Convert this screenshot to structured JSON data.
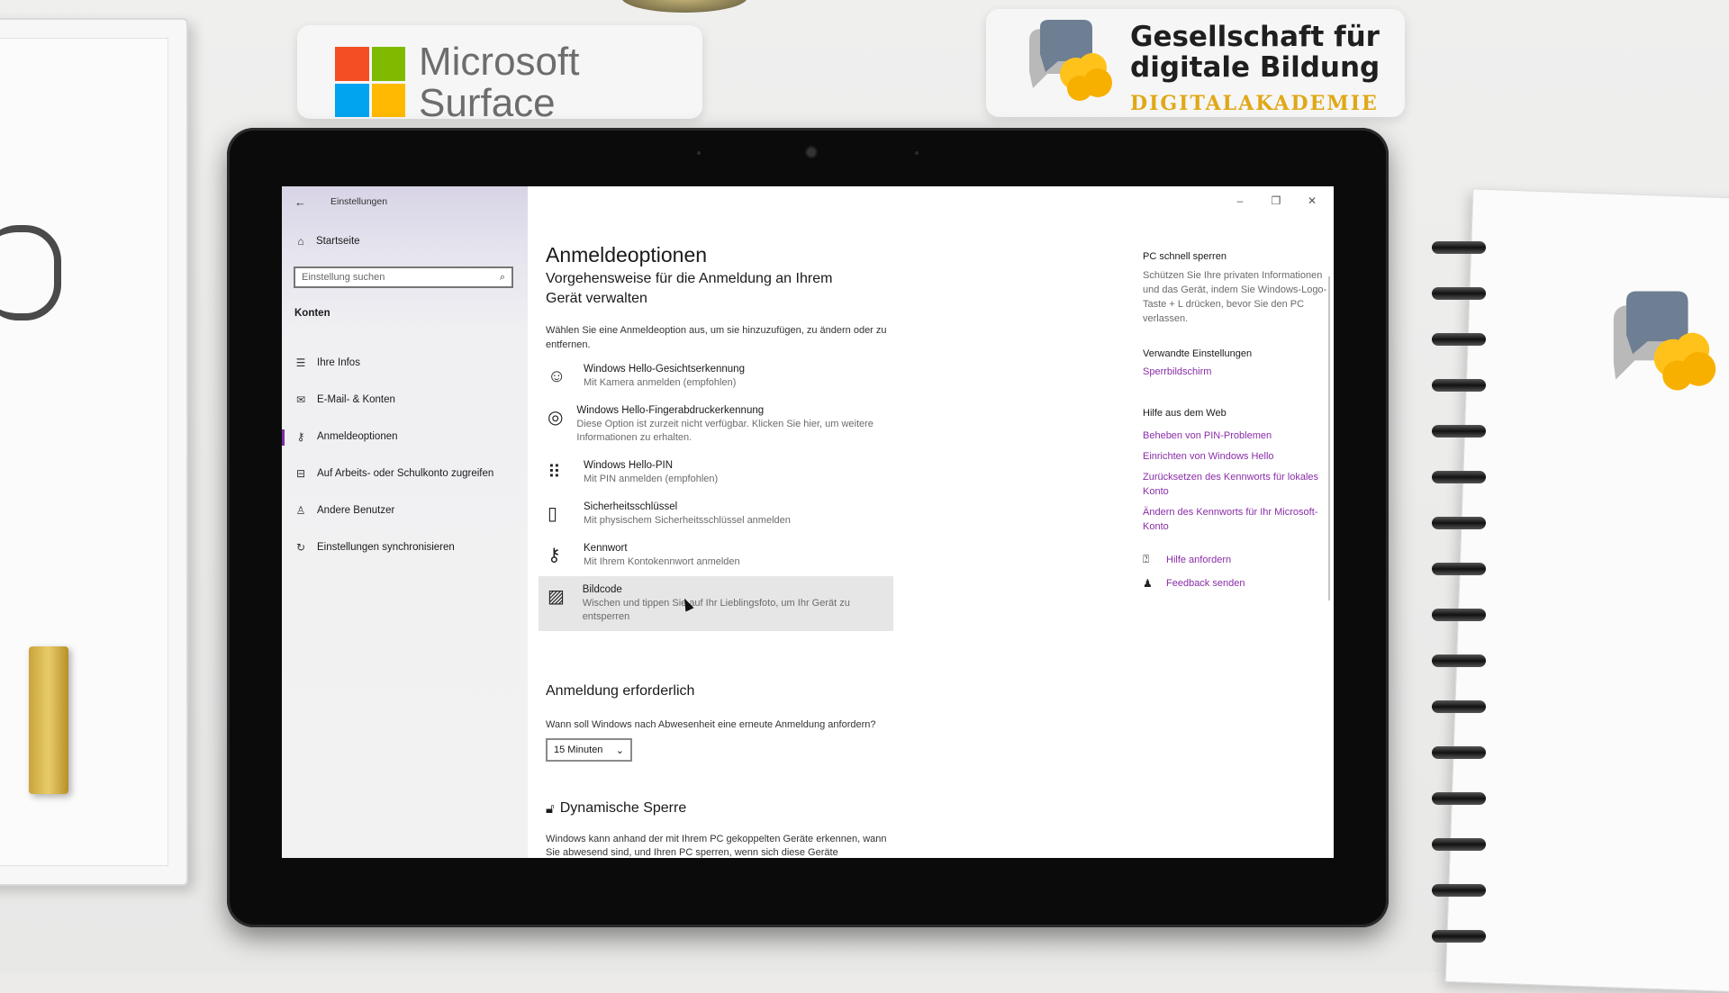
{
  "background": {
    "ms_brand": {
      "line1": "Microsoft",
      "line2": "Surface"
    },
    "org_brand": {
      "line1": "Gesellschaft für",
      "line2": "digitale Bildung",
      "line3": "DIGITALAKADEMIE"
    },
    "colors": {
      "ms_red": "#f25022",
      "ms_green": "#7fba00",
      "ms_blue": "#00a4ef",
      "ms_yellow": "#ffb900",
      "org_gold": "#e0a817",
      "org_gray": "#6e7f93"
    }
  },
  "window": {
    "app_title": "Einstellungen",
    "controls": {
      "minimize": "–",
      "maximize": "❐",
      "close": "✕"
    }
  },
  "sidebar": {
    "home_label": "Startseite",
    "search_placeholder": "Einstellung suchen",
    "section_label": "Konten",
    "accent": "#7a2f9e",
    "items": [
      {
        "label": "Ihre Infos",
        "icon": "person-card-icon",
        "glyph": "☰",
        "active": false
      },
      {
        "label": "E-Mail- & Konten",
        "icon": "mail-icon",
        "glyph": "✉",
        "active": false
      },
      {
        "label": "Anmeldeoptionen",
        "icon": "key-icon",
        "glyph": "⚷",
        "active": true
      },
      {
        "label": "Auf Arbeits- oder Schulkonto zugreifen",
        "icon": "briefcase-icon",
        "glyph": "⊟",
        "active": false
      },
      {
        "label": "Andere Benutzer",
        "icon": "person-icon",
        "glyph": "♙",
        "active": false
      },
      {
        "label": "Einstellungen synchronisieren",
        "icon": "sync-icon",
        "glyph": "↻",
        "active": false
      }
    ]
  },
  "main": {
    "title": "Anmeldeoptionen",
    "manage_heading": "Vorgehensweise für die Anmeldung an Ihrem Gerät verwalten",
    "intro": "Wählen Sie eine Anmeldeoption aus, um sie hinzuzufügen, zu ändern oder zu entfernen.",
    "options": [
      {
        "title": "Windows Hello-Gesichtserkennung",
        "desc": "Mit Kamera anmelden (empfohlen)",
        "icon": "face-icon",
        "glyph": "☺"
      },
      {
        "title": "Windows Hello-Fingerabdruckerkennung",
        "desc": "Diese Option ist zurzeit nicht verfügbar. Klicken Sie hier, um weitere Informationen zu erhalten.",
        "icon": "fingerprint-icon",
        "glyph": "◎"
      },
      {
        "title": "Windows Hello-PIN",
        "desc": "Mit PIN anmelden (empfohlen)",
        "icon": "keypad-icon",
        "glyph": "⠿"
      },
      {
        "title": "Sicherheitsschlüssel",
        "desc": "Mit physischem Sicherheitsschlüssel anmelden",
        "icon": "usb-key-icon",
        "glyph": "▯"
      },
      {
        "title": "Kennwort",
        "desc": "Mit Ihrem Kontokennwort anmelden",
        "icon": "key-icon",
        "glyph": "⚷"
      },
      {
        "title": "Bildcode",
        "desc": "Wischen und tippen Sie auf Ihr Lieblingsfoto, um Ihr Gerät zu entsperren",
        "icon": "picture-icon",
        "glyph": "▨"
      }
    ],
    "required_heading": "Anmeldung erforderlich",
    "required_question": "Wann soll Windows nach Abwesenheit eine erneute Anmeldung anfordern?",
    "required_value": "15 Minuten",
    "dynamic_heading": "Dynamische Sperre",
    "dynamic_text": "Windows kann anhand der mit Ihrem PC gekoppelten Geräte erkennen, wann Sie abwesend sind, und Ihren PC sperren, wenn sich diese Geräte"
  },
  "aside": {
    "lock_heading": "PC schnell sperren",
    "lock_text": "Schützen Sie Ihre privaten Informationen und das Gerät, indem Sie Windows-Logo-Taste + L drücken, bevor Sie den PC verlassen.",
    "related_heading": "Verwandte Einstellungen",
    "related_link": "Sperrbildschirm",
    "web_heading": "Hilfe aus dem Web",
    "web_links": [
      "Beheben von PIN-Problemen",
      "Einrichten von Windows Hello",
      "Zurücksetzen des Kennworts für lokales Konto",
      "Ändern des Kennworts für Ihr Microsoft-Konto"
    ],
    "help_label": "Hilfe anfordern",
    "feedback_label": "Feedback senden",
    "link_color": "#8a2da8"
  }
}
